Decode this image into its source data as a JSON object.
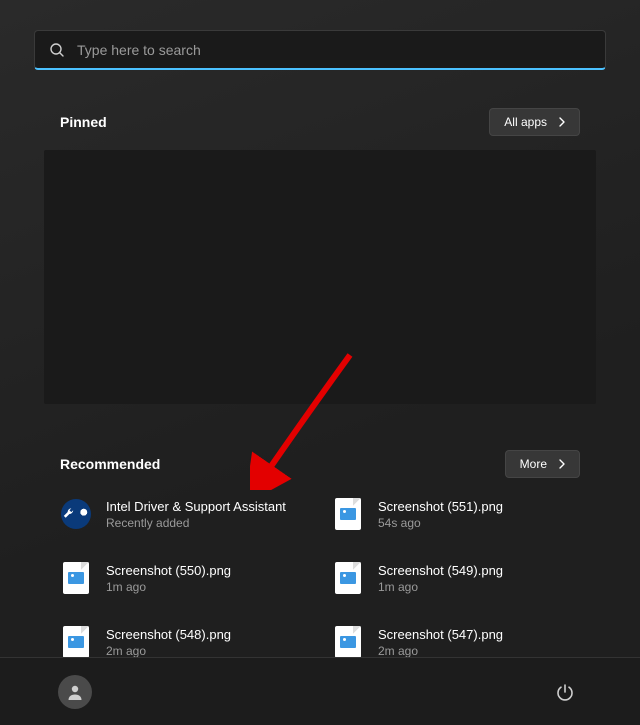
{
  "search": {
    "placeholder": "Type here to search"
  },
  "pinned": {
    "title": "Pinned",
    "button": "All apps"
  },
  "recommended": {
    "title": "Recommended",
    "button": "More",
    "items": [
      {
        "title": "Intel Driver & Support Assistant",
        "sub": "Recently added",
        "icon": "intel"
      },
      {
        "title": "Screenshot (551).png",
        "sub": "54s ago",
        "icon": "image"
      },
      {
        "title": "Screenshot (550).png",
        "sub": "1m ago",
        "icon": "image"
      },
      {
        "title": "Screenshot (549).png",
        "sub": "1m ago",
        "icon": "image"
      },
      {
        "title": "Screenshot (548).png",
        "sub": "2m ago",
        "icon": "image"
      },
      {
        "title": "Screenshot (547).png",
        "sub": "2m ago",
        "icon": "image"
      }
    ]
  }
}
